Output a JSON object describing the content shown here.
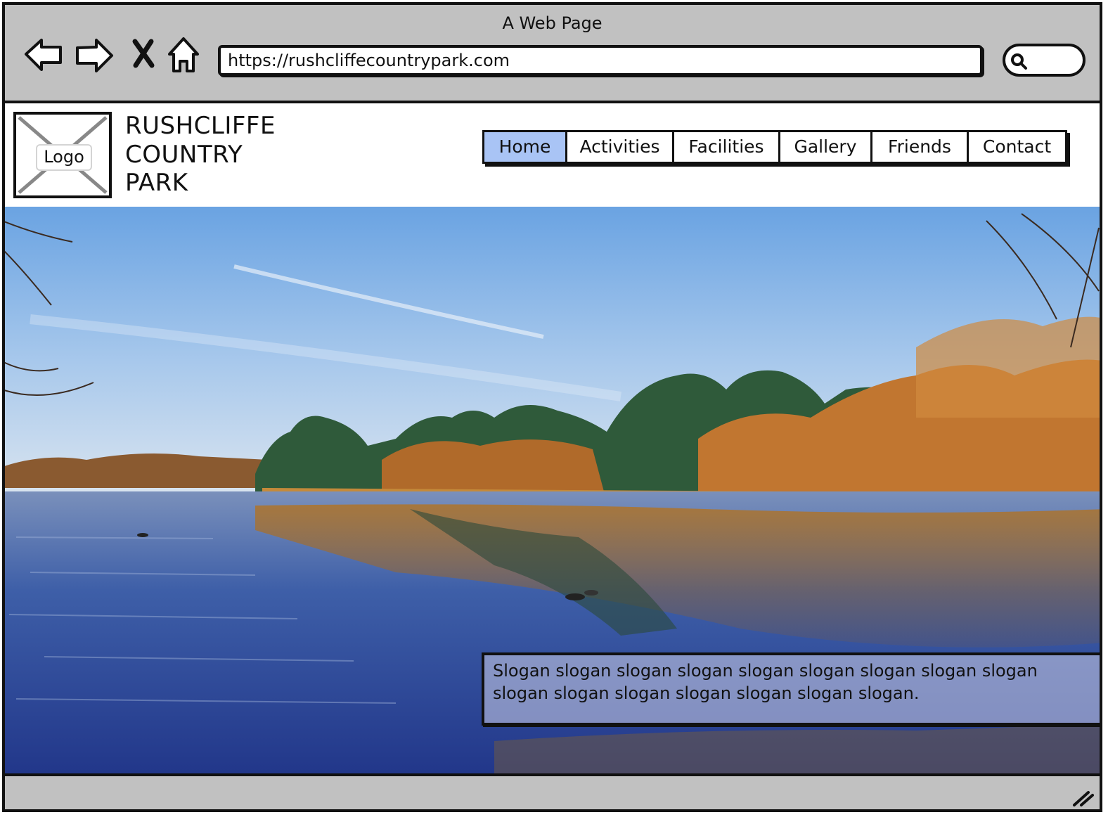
{
  "browser": {
    "window_title": "A Web Page",
    "url": "https://rushcliffecountrypark.com",
    "controls": [
      "back-arrow-icon",
      "forward-arrow-icon",
      "close-x-icon",
      "home-icon",
      "search-icon"
    ]
  },
  "site": {
    "logo_label": "Logo",
    "title_lines": [
      "RUSHCLIFFE",
      "COUNTRY",
      "PARK"
    ]
  },
  "nav": {
    "items": [
      {
        "label": "Home",
        "active": true
      },
      {
        "label": "Activities",
        "active": false
      },
      {
        "label": "Facilities",
        "active": false
      },
      {
        "label": "Gallery",
        "active": false
      },
      {
        "label": "Friends",
        "active": false
      },
      {
        "label": "Contact",
        "active": false
      }
    ]
  },
  "hero": {
    "image": "lake-photo-autumn-trees",
    "slogan": "Slogan slogan slogan  slogan slogan slogan slogan slogan slogan slogan slogan slogan slogan slogan slogan slogan."
  },
  "colors": {
    "chrome_gray": "#c1c1c1",
    "active_nav": "#a9c4f5",
    "outline": "#111111"
  }
}
